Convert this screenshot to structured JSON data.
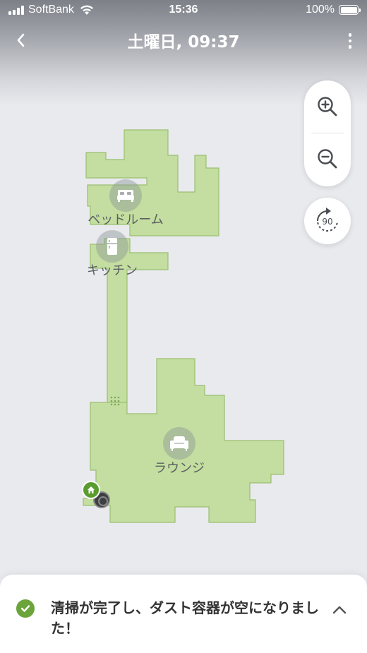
{
  "status_bar": {
    "carrier": "SoftBank",
    "time": "15:36",
    "battery": "100%",
    "battery_level": 1.0
  },
  "nav": {
    "title": "土曜日, 09:37",
    "back_icon": "chevron-left-icon",
    "more_icon": "more-vertical-icon"
  },
  "colors": {
    "floor": "#c3dea0",
    "floor_edge": "#9bbf72",
    "accent_green": "#6aa43a",
    "background": "#e9eaee"
  },
  "map": {
    "rooms": [
      {
        "label": "ベッドルーム",
        "icon": "bed-icon"
      },
      {
        "label": "キッチン",
        "icon": "fridge-icon"
      },
      {
        "label": "ラウンジ",
        "icon": "armchair-icon"
      }
    ],
    "dock_icon": "home-icon",
    "robot_icon": "robot-icon",
    "marker_icon": "grid-dots-icon"
  },
  "controls": {
    "zoom_in_icon": "zoom-in-icon",
    "zoom_out_icon": "zoom-out-icon",
    "rotate_label": "90",
    "rotate_icon": "rotate-icon"
  },
  "sheet": {
    "message": "清掃が完了し、ダスト容器が空になりました！",
    "check_icon": "check-circle-icon",
    "expand_icon": "chevron-up-icon"
  }
}
